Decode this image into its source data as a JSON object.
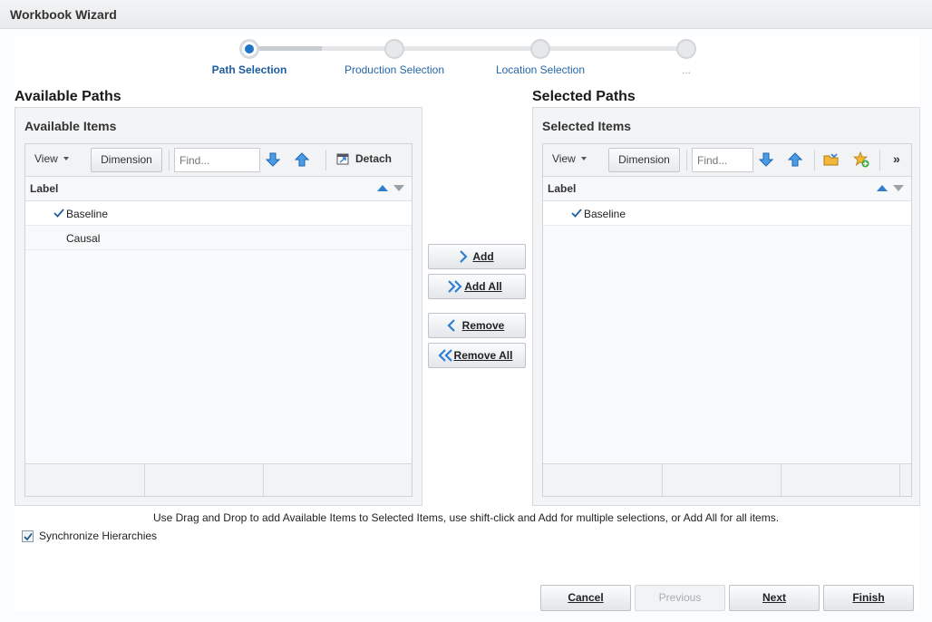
{
  "window": {
    "title": "Workbook Wizard"
  },
  "train": {
    "steps": [
      {
        "label": "Path Selection"
      },
      {
        "label": "Production Selection"
      },
      {
        "label": "Location Selection"
      },
      {
        "label": "..."
      }
    ]
  },
  "available": {
    "section_title": "Available Paths",
    "panel_title": "Available Items",
    "toolbar": {
      "view_label": "View",
      "dimension_label": "Dimension",
      "find_placeholder": "Find...",
      "detach_label": "Detach"
    },
    "column_label": "Label",
    "rows": [
      {
        "label": "Baseline",
        "checked": true
      },
      {
        "label": "Causal",
        "checked": false
      }
    ]
  },
  "selected": {
    "section_title": "Selected Paths",
    "panel_title": "Selected Items",
    "toolbar": {
      "view_label": "View",
      "dimension_label": "Dimension",
      "find_placeholder": "Find...",
      "more_label": "»"
    },
    "column_label": "Label",
    "rows": [
      {
        "label": "Baseline",
        "checked": true
      }
    ]
  },
  "shuttle": {
    "add": "Add",
    "add_all": "Add All",
    "remove": "Remove",
    "remove_all": "Remove All"
  },
  "instructions": "Use Drag and Drop to add Available Items to Selected Items, use shift-click and Add for multiple selections, or Add All for all items.",
  "sync": {
    "label": "Synchronize Hierarchies",
    "checked": true
  },
  "footer": {
    "cancel": "Cancel",
    "previous": "Previous",
    "next": "Next",
    "finish": "Finish"
  },
  "colors": {
    "accent": "#1f74c7",
    "link": "#2566a8"
  }
}
